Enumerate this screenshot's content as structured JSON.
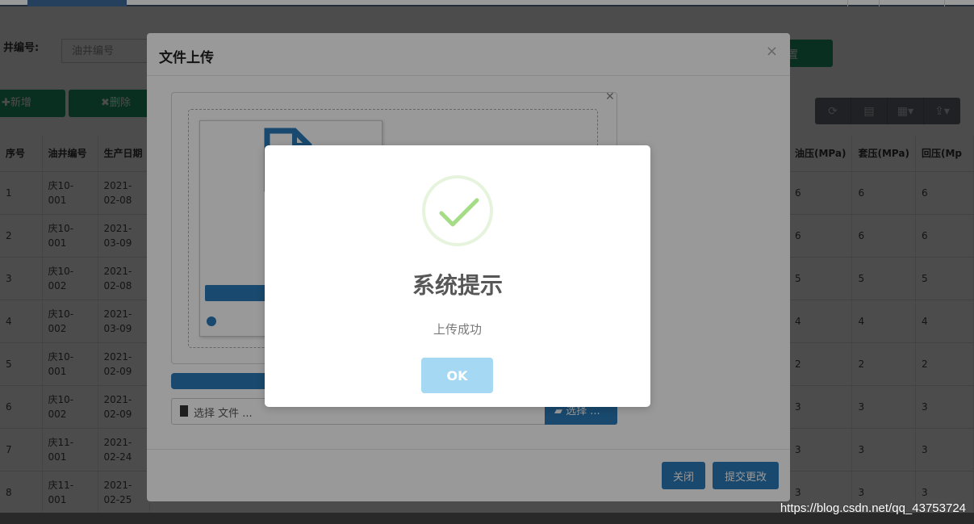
{
  "search": {
    "label": "井编号:",
    "placeholder": "油井编号",
    "reset_label": "置"
  },
  "toolbar": {
    "new_label": "✚新增",
    "delete_label": "✖删除"
  },
  "table": {
    "headers": [
      "序号",
      "油井编号",
      "生产日期"
    ],
    "right_headers": [
      "油压(MPa)",
      "套压(MPa)",
      "回压(Mp"
    ],
    "rows": [
      {
        "no": "1",
        "well": "庆10-001",
        "date": "2021-02-08",
        "oil": "6",
        "casing": "6",
        "back": "6"
      },
      {
        "no": "2",
        "well": "庆10-001",
        "date": "2021-03-09",
        "oil": "6",
        "casing": "6",
        "back": "6"
      },
      {
        "no": "3",
        "well": "庆10-002",
        "date": "2021-02-08",
        "oil": "5",
        "casing": "5",
        "back": "5"
      },
      {
        "no": "4",
        "well": "庆10-002",
        "date": "2021-03-09",
        "oil": "4",
        "casing": "4",
        "back": "4"
      },
      {
        "no": "5",
        "well": "庆10-001",
        "date": "2021-02-09",
        "oil": "2",
        "casing": "2",
        "back": "2"
      },
      {
        "no": "6",
        "well": "庆10-002",
        "date": "2021-02-09",
        "oil": "3",
        "casing": "3",
        "back": "3"
      },
      {
        "no": "7",
        "well": "庆11-001",
        "date": "2021-02-24",
        "oil": "3",
        "casing": "3",
        "back": "3"
      },
      {
        "no": "8",
        "well": "庆11-001",
        "date": "2021-02-25",
        "oil": "3",
        "casing": "3",
        "back": "3"
      }
    ]
  },
  "upload_modal": {
    "title": "文件上传",
    "close_symbol": "×",
    "box_close_symbol": "✕",
    "file_placeholder": "选择 文件 ...",
    "choose_label": "选择 ...",
    "close_label": "关闭",
    "submit_label": "提交更改"
  },
  "alert": {
    "title": "系统提示",
    "message": "上传成功",
    "ok_label": "OK"
  },
  "watermark": "https://blog.csdn.net/qq_43753724",
  "colors": {
    "green": "#1e9e70",
    "blue": "#2a7ab8",
    "ok_button": "#a5d9f3",
    "check": "#a5dc86"
  }
}
